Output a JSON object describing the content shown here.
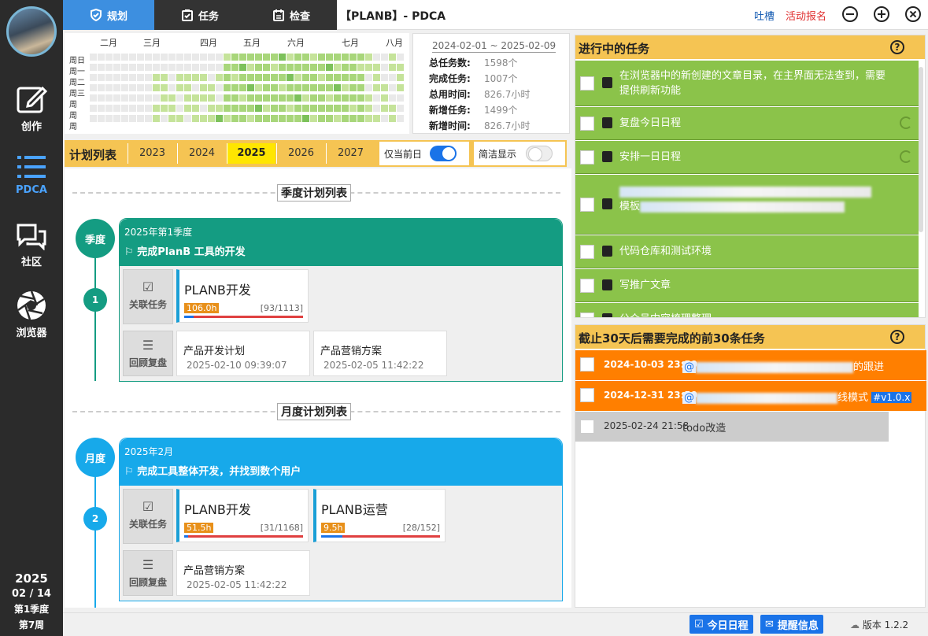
{
  "sidebar": {
    "items": [
      {
        "label": "创作",
        "icon": "edit-icon"
      },
      {
        "label": "PDCA",
        "icon": "list-icon"
      },
      {
        "label": "社区",
        "icon": "chat-icon"
      },
      {
        "label": "浏览器",
        "icon": "aperture-icon"
      }
    ],
    "date": {
      "year": "2025",
      "day": "02 / 14",
      "quarter": "第1季度",
      "week": "第7周"
    }
  },
  "topbar": {
    "tabs": [
      {
        "label": "规划"
      },
      {
        "label": "任务"
      },
      {
        "label": "检查"
      }
    ],
    "title": "【PLANB】- PDCA",
    "feedback": "吐槽",
    "event": "活动报名"
  },
  "heatmap": {
    "months": [
      "二月",
      "三月",
      "四月",
      "五月",
      "六月",
      "七月",
      "八月"
    ],
    "days": [
      "周日",
      "周一",
      "周二",
      "周三",
      "周",
      "周",
      "周"
    ]
  },
  "stats": {
    "range": "2024-02-01 ~ 2025-02-09",
    "rows": [
      {
        "label": "总任务数:",
        "value": "1598个"
      },
      {
        "label": "完成任务:",
        "value": "1007个"
      },
      {
        "label": "总用时间:",
        "value": "826.7小时"
      },
      {
        "label": "新增任务:",
        "value": "1499个"
      },
      {
        "label": "新增时间:",
        "value": "826.7小时"
      }
    ]
  },
  "plan": {
    "title": "计划列表",
    "years": [
      "2023",
      "2024",
      "2025",
      "2026",
      "2027"
    ],
    "selected_year": "2025",
    "today_only": "仅当前日",
    "compact": "简洁显示"
  },
  "quarter": {
    "section": "季度计划列表",
    "badge": "季度",
    "number": "1",
    "period": "2025年第1季度",
    "goal": "完成PlanB 工具的开发",
    "related": "关联任务",
    "review": "回顾复盘",
    "tasks": [
      {
        "name": "PLANB开发",
        "hours": "106.0h",
        "count": "[93/1113]",
        "progress": 0.08
      }
    ],
    "reviews": [
      {
        "title": "产品开发计划",
        "time": "2025-02-10 09:39:07"
      },
      {
        "title": "产品营销方案",
        "time": "2025-02-05 11:42:22"
      }
    ]
  },
  "month": {
    "section": "月度计划列表",
    "badge": "月度",
    "number": "2",
    "period": "2025年2月",
    "goal": "完成工具整体开发，并找到数个用户",
    "related": "关联任务",
    "review": "回顾复盘",
    "tasks": [
      {
        "name": "PLANB开发",
        "hours": "51.5h",
        "count": "[31/1168]",
        "progress": 0.03
      },
      {
        "name": "PLANB运营",
        "hours": "9.5h",
        "count": "[28/152]",
        "progress": 0.18
      }
    ],
    "reviews": [
      {
        "title": "产品营销方案",
        "time": "2025-02-05 11:42:22"
      }
    ]
  },
  "inprogress": {
    "title": "进行中的任务",
    "items": [
      {
        "text": "在浏览器中的新创建的文章目录，在主界面无法查到，需要提供刷新功能"
      },
      {
        "text": "复盘今日日程"
      },
      {
        "text": "安排一日日程"
      },
      {
        "text": "模板"
      },
      {
        "text": "代码仓库和测试环境"
      },
      {
        "text": "写推广文章"
      },
      {
        "text": "公众号内容梳理整理"
      }
    ]
  },
  "deadline": {
    "title": "截止30天后需要完成的前30条任务",
    "items": [
      {
        "date": "2024-10-03 23:59",
        "text": "@",
        "tail": "的跟进",
        "color": "#ff7f00"
      },
      {
        "date": "2024-12-31 23:59",
        "text": "@",
        "tail": "线模式",
        "tag": "#v1.0.x",
        "color": "#ff7f00"
      },
      {
        "date": "2025-02-24 21:58",
        "text": "todo改造",
        "color": "#cccccc"
      }
    ]
  },
  "footer": {
    "today": "今日日程",
    "remind": "提醒信息",
    "version": "版本 1.2.2"
  }
}
